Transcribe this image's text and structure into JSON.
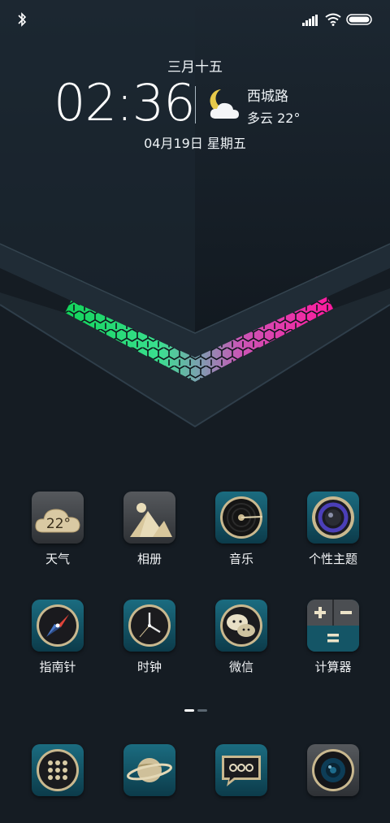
{
  "status_bar": {
    "bluetooth_icon": "bluetooth-icon",
    "signal_icon": "signal-icon",
    "wifi_icon": "wifi-icon",
    "battery_icon": "battery-icon"
  },
  "lockclock": {
    "lunar_date": "三月十五",
    "time": "02:36",
    "city": "西城路",
    "weather": "多云 22°",
    "date": "04月19日 星期五",
    "weather_icon": "moon-cloud-icon"
  },
  "apps_row1": [
    {
      "label": "天气",
      "icon": "weather-cloud-icon",
      "tile_text": "22°"
    },
    {
      "label": "相册",
      "icon": "photo-mountain-icon"
    },
    {
      "label": "音乐",
      "icon": "vinyl-record-icon"
    },
    {
      "label": "个性主题",
      "icon": "theme-lens-icon"
    }
  ],
  "apps_row2": [
    {
      "label": "指南针",
      "icon": "compass-icon"
    },
    {
      "label": "时钟",
      "icon": "clock-icon"
    },
    {
      "label": "微信",
      "icon": "wechat-icon"
    },
    {
      "label": "计算器",
      "icon": "calculator-icon"
    }
  ],
  "dock": [
    {
      "icon": "dialer-keypad-icon"
    },
    {
      "icon": "planet-browser-icon"
    },
    {
      "icon": "messages-icon"
    },
    {
      "icon": "camera-lens-icon"
    }
  ],
  "page_indicator": {
    "pages": 2,
    "current": 1
  },
  "colors": {
    "background": "#161d24",
    "accent_green": "#22e07a",
    "accent_pink": "#ff2aa8",
    "tile_teal": "#134f60"
  }
}
